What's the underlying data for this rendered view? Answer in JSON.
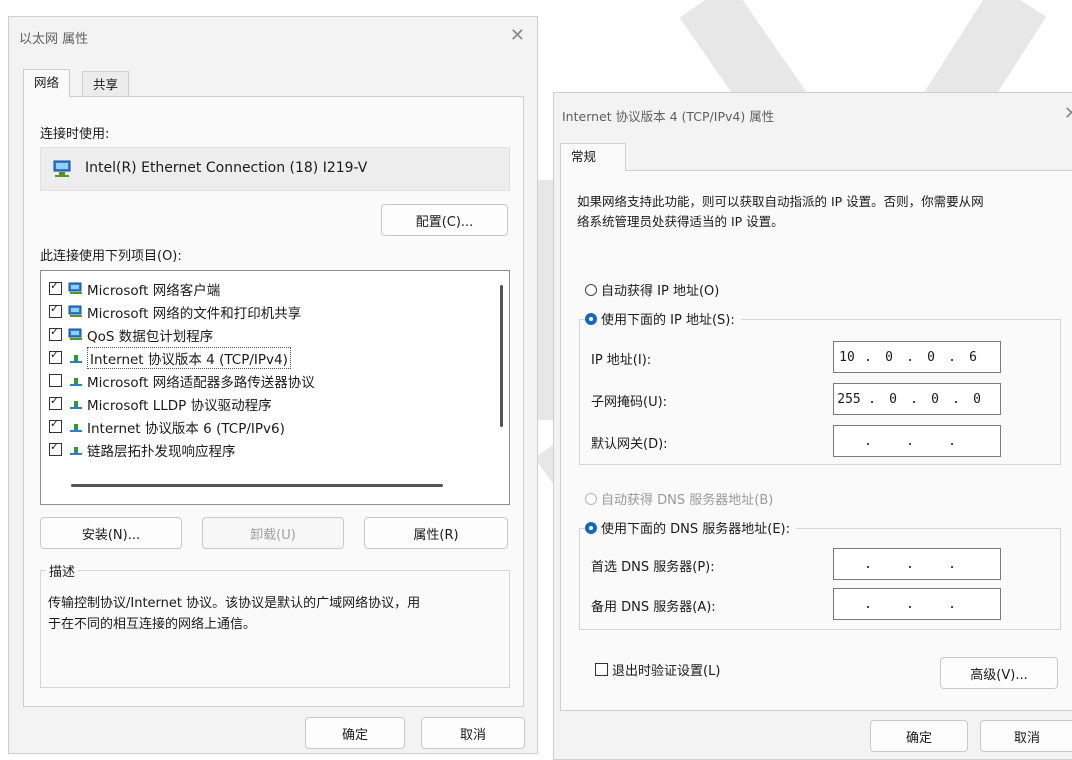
{
  "left_dialog": {
    "title": "以太网 属性",
    "tabs": [
      "网络",
      "共享"
    ],
    "connect_using_label": "连接时使用:",
    "adapter_name": "Intel(R) Ethernet Connection (18) I219-V",
    "configure_button": "配置(C)...",
    "items_label": "此连接使用下列项目(O):",
    "items": [
      {
        "label": "Microsoft 网络客户端",
        "checked": true,
        "icon": "network-client-icon"
      },
      {
        "label": "Microsoft 网络的文件和打印机共享",
        "checked": true,
        "icon": "file-sharing-icon"
      },
      {
        "label": "QoS 数据包计划程序",
        "checked": true,
        "icon": "qos-scheduler-icon"
      },
      {
        "label": "Internet 协议版本 4 (TCP/IPv4)",
        "checked": true,
        "icon": "protocol-icon",
        "selected": true
      },
      {
        "label": "Microsoft 网络适配器多路传送器协议",
        "checked": false,
        "icon": "protocol-icon"
      },
      {
        "label": "Microsoft LLDP 协议驱动程序",
        "checked": true,
        "icon": "protocol-icon"
      },
      {
        "label": "Internet 协议版本 6 (TCP/IPv6)",
        "checked": true,
        "icon": "protocol-icon"
      },
      {
        "label": "链路层拓扑发现响应程序",
        "checked": true,
        "icon": "protocol-icon"
      }
    ],
    "install_button": "安装(N)...",
    "uninstall_button": "卸载(U)",
    "properties_button": "属性(R)",
    "description_label": "描述",
    "description_text_line1": "传输控制协议/Internet 协议。该协议是默认的广域网络协议，用",
    "description_text_line2": "于在不同的相互连接的网络上通信。",
    "ok_button": "确定",
    "cancel_button": "取消"
  },
  "right_dialog": {
    "title": "Internet 协议版本 4 (TCP/IPv4) 属性",
    "tab": "常规",
    "intro_line1": "如果网络支持此功能，则可以获取自动指派的 IP 设置。否则，你需要从网",
    "intro_line2": "络系统管理员处获得适当的 IP 设置。",
    "auto_ip_radio": "自动获得 IP 地址(O)",
    "manual_ip_radio": "使用下面的 IP 地址(S):",
    "ip_label": "IP 地址(I):",
    "ip_value": [
      "10",
      "0",
      "0",
      "6"
    ],
    "mask_label": "子网掩码(U):",
    "mask_value": [
      "255",
      "0",
      "0",
      "0"
    ],
    "gateway_label": "默认网关(D):",
    "auto_dns_radio": "自动获得 DNS 服务器地址(B)",
    "manual_dns_radio": "使用下面的 DNS 服务器地址(E):",
    "preferred_dns_label": "首选 DNS 服务器(P):",
    "alternate_dns_label": "备用 DNS 服务器(A):",
    "validate_checkbox": "退出时验证设置(L)",
    "advanced_button": "高级(V)...",
    "ok_button": "确定",
    "cancel_button": "取消"
  },
  "colors": {
    "accent": "#1368c4",
    "dialog_bg": "#f3f3f3",
    "watermark": "#d8d8d8"
  }
}
